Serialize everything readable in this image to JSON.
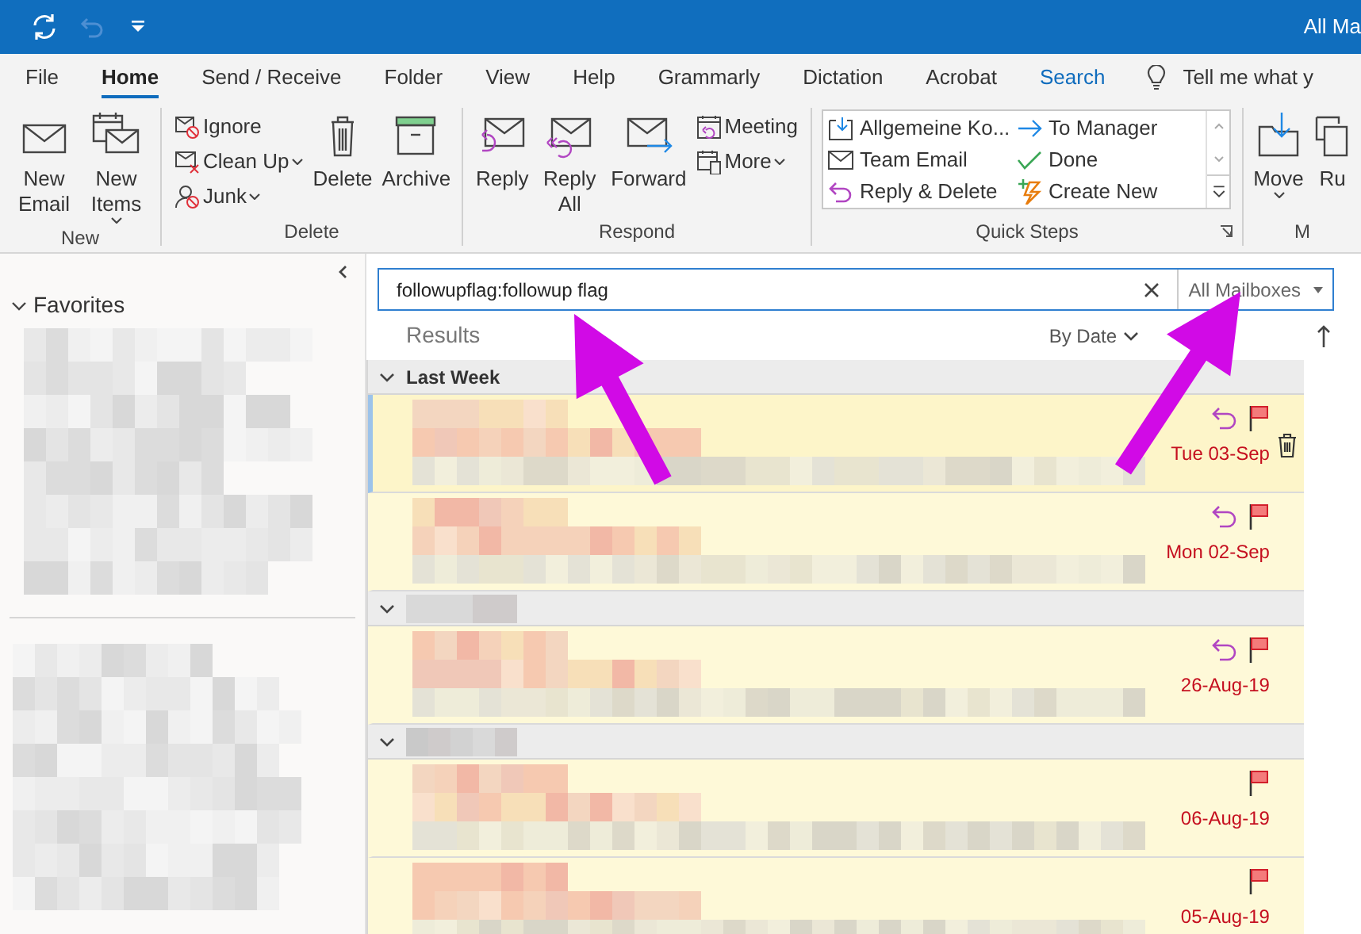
{
  "title_bar": {
    "title": "All Ma"
  },
  "ribbon_tabs": [
    {
      "label": "File",
      "selected": false,
      "contextual": false
    },
    {
      "label": "Home",
      "selected": true,
      "contextual": false
    },
    {
      "label": "Send / Receive",
      "selected": false,
      "contextual": false
    },
    {
      "label": "Folder",
      "selected": false,
      "contextual": false
    },
    {
      "label": "View",
      "selected": false,
      "contextual": false
    },
    {
      "label": "Help",
      "selected": false,
      "contextual": false
    },
    {
      "label": "Grammarly",
      "selected": false,
      "contextual": false
    },
    {
      "label": "Dictation",
      "selected": false,
      "contextual": false
    },
    {
      "label": "Acrobat",
      "selected": false,
      "contextual": false
    },
    {
      "label": "Search",
      "selected": false,
      "contextual": true
    }
  ],
  "tell_me": "Tell me what y",
  "ribbon_groups": [
    {
      "label": "New",
      "kind": "commands",
      "commands": [
        {
          "label": "New Email",
          "kind": "large",
          "dropdown": false
        },
        {
          "label": "New Items",
          "kind": "large",
          "dropdown": true
        }
      ]
    },
    {
      "label": "Delete",
      "kind": "commands",
      "commands": [
        {
          "label": "Ignore",
          "kind": "small",
          "dropdown": false
        },
        {
          "label": "Clean Up",
          "kind": "small",
          "dropdown": true
        },
        {
          "label": "Junk",
          "kind": "small",
          "dropdown": true
        },
        {
          "label": "Delete",
          "kind": "large",
          "dropdown": false
        },
        {
          "label": "Archive",
          "kind": "large",
          "dropdown": false
        }
      ]
    },
    {
      "label": "Respond",
      "kind": "commands",
      "commands": [
        {
          "label": "Reply",
          "kind": "large",
          "dropdown": false
        },
        {
          "label": "Reply All",
          "kind": "large",
          "dropdown": false
        },
        {
          "label": "Forward",
          "kind": "large",
          "dropdown": false
        },
        {
          "label": "Meeting",
          "kind": "small",
          "dropdown": false
        },
        {
          "label": "More",
          "kind": "small",
          "dropdown": true
        }
      ]
    },
    {
      "label": "Quick Steps",
      "kind": "gallery",
      "items": [
        "Allgemeine Ko...",
        "To Manager",
        "Team Email",
        "Done",
        "Reply & Delete",
        "Create New"
      ]
    },
    {
      "label": "M",
      "kind": "commands",
      "commands": [
        {
          "label": "Move",
          "kind": "large",
          "dropdown": true
        },
        {
          "label": "Ru",
          "kind": "large",
          "dropdown": false
        }
      ]
    }
  ],
  "favorites": {
    "label": "Favorites",
    "expanded": true
  },
  "search": {
    "value": "followupflag:followup flag",
    "scope": "All Mailboxes"
  },
  "results": {
    "label": "Results",
    "sort": "By Date"
  },
  "mail_list": [
    {
      "kind": "group",
      "label": "Last Week",
      "expanded": true
    },
    {
      "kind": "message",
      "date": "Tue 03-Sep",
      "selected": true,
      "replied": true,
      "flagged": true
    },
    {
      "kind": "message",
      "date": "Mon 02-Sep",
      "selected": false,
      "replied": true,
      "flagged": true
    },
    {
      "kind": "group",
      "expanded": true
    },
    {
      "kind": "message",
      "date": "26-Aug-19",
      "selected": false,
      "replied": true,
      "flagged": true
    },
    {
      "kind": "group",
      "expanded": true
    },
    {
      "kind": "message",
      "date": "06-Aug-19",
      "selected": false,
      "replied": false,
      "flagged": true
    },
    {
      "kind": "message",
      "date": "05-Aug-19",
      "selected": false,
      "replied": false,
      "flagged": true
    }
  ]
}
